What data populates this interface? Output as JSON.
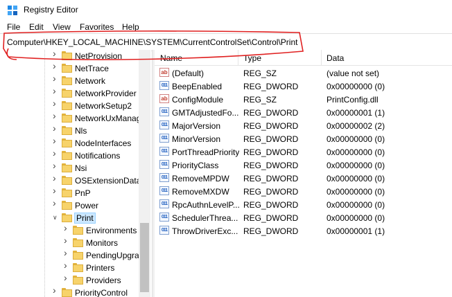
{
  "window": {
    "title": "Registry Editor"
  },
  "menu": [
    "File",
    "Edit",
    "View",
    "Favorites",
    "Help"
  ],
  "address": "Computer\\HKEY_LOCAL_MACHINE\\SYSTEM\\CurrentControlSet\\Control\\Print",
  "colors": {
    "selection": "#cce8ff",
    "annotation": "#e02020",
    "folder": "#f7d36b"
  },
  "tree": {
    "items": [
      {
        "label": "NetProvision",
        "level": 1,
        "expanded": false,
        "selected": false
      },
      {
        "label": "NetTrace",
        "level": 1,
        "expanded": false,
        "selected": false
      },
      {
        "label": "Network",
        "level": 1,
        "expanded": false,
        "selected": false
      },
      {
        "label": "NetworkProvider",
        "level": 1,
        "expanded": false,
        "selected": false
      },
      {
        "label": "NetworkSetup2",
        "level": 1,
        "expanded": false,
        "selected": false
      },
      {
        "label": "NetworkUxManag",
        "level": 1,
        "expanded": false,
        "selected": false
      },
      {
        "label": "Nls",
        "level": 1,
        "expanded": false,
        "selected": false
      },
      {
        "label": "NodeInterfaces",
        "level": 1,
        "expanded": false,
        "selected": false
      },
      {
        "label": "Notifications",
        "level": 1,
        "expanded": false,
        "selected": false
      },
      {
        "label": "Nsi",
        "level": 1,
        "expanded": false,
        "selected": false
      },
      {
        "label": "OSExtensionDatal",
        "level": 1,
        "expanded": false,
        "selected": false
      },
      {
        "label": "PnP",
        "level": 1,
        "expanded": false,
        "selected": false
      },
      {
        "label": "Power",
        "level": 1,
        "expanded": false,
        "selected": false
      },
      {
        "label": "Print",
        "level": 1,
        "expanded": true,
        "selected": true
      },
      {
        "label": "Environments",
        "level": 2,
        "expanded": false,
        "selected": false
      },
      {
        "label": "Monitors",
        "level": 2,
        "expanded": false,
        "selected": false
      },
      {
        "label": "PendingUpgra",
        "level": 2,
        "expanded": false,
        "selected": false
      },
      {
        "label": "Printers",
        "level": 2,
        "expanded": false,
        "selected": false
      },
      {
        "label": "Providers",
        "level": 2,
        "expanded": false,
        "selected": false
      },
      {
        "label": "PriorityControl",
        "level": 1,
        "expanded": false,
        "selected": false
      }
    ]
  },
  "list": {
    "headers": {
      "name": "Name",
      "type": "Type",
      "data": "Data"
    },
    "rows": [
      {
        "icon": "string-value-icon",
        "kind": "sz",
        "glyph": "ab",
        "name": "(Default)",
        "type": "REG_SZ",
        "data": "(value not set)"
      },
      {
        "icon": "dword-value-icon",
        "kind": "dw",
        "glyph": "011",
        "name": "BeepEnabled",
        "type": "REG_DWORD",
        "data": "0x00000000 (0)"
      },
      {
        "icon": "string-value-icon",
        "kind": "sz",
        "glyph": "ab",
        "name": "ConfigModule",
        "type": "REG_SZ",
        "data": "PrintConfig.dll"
      },
      {
        "icon": "dword-value-icon",
        "kind": "dw",
        "glyph": "011",
        "name": "GMTAdjustedFo...",
        "type": "REG_DWORD",
        "data": "0x00000001 (1)"
      },
      {
        "icon": "dword-value-icon",
        "kind": "dw",
        "glyph": "011",
        "name": "MajorVersion",
        "type": "REG_DWORD",
        "data": "0x00000002 (2)"
      },
      {
        "icon": "dword-value-icon",
        "kind": "dw",
        "glyph": "011",
        "name": "MinorVersion",
        "type": "REG_DWORD",
        "data": "0x00000000 (0)"
      },
      {
        "icon": "dword-value-icon",
        "kind": "dw",
        "glyph": "011",
        "name": "PortThreadPriority",
        "type": "REG_DWORD",
        "data": "0x00000000 (0)"
      },
      {
        "icon": "dword-value-icon",
        "kind": "dw",
        "glyph": "011",
        "name": "PriorityClass",
        "type": "REG_DWORD",
        "data": "0x00000000 (0)"
      },
      {
        "icon": "dword-value-icon",
        "kind": "dw",
        "glyph": "011",
        "name": "RemoveMPDW",
        "type": "REG_DWORD",
        "data": "0x00000000 (0)"
      },
      {
        "icon": "dword-value-icon",
        "kind": "dw",
        "glyph": "011",
        "name": "RemoveMXDW",
        "type": "REG_DWORD",
        "data": "0x00000000 (0)"
      },
      {
        "icon": "dword-value-icon",
        "kind": "dw",
        "glyph": "011",
        "name": "RpcAuthnLevelP...",
        "type": "REG_DWORD",
        "data": "0x00000000 (0)"
      },
      {
        "icon": "dword-value-icon",
        "kind": "dw",
        "glyph": "011",
        "name": "SchedulerThrea...",
        "type": "REG_DWORD",
        "data": "0x00000000 (0)"
      },
      {
        "icon": "dword-value-icon",
        "kind": "dw",
        "glyph": "011",
        "name": "ThrowDriverExc...",
        "type": "REG_DWORD",
        "data": "0x00000001 (1)"
      }
    ]
  }
}
